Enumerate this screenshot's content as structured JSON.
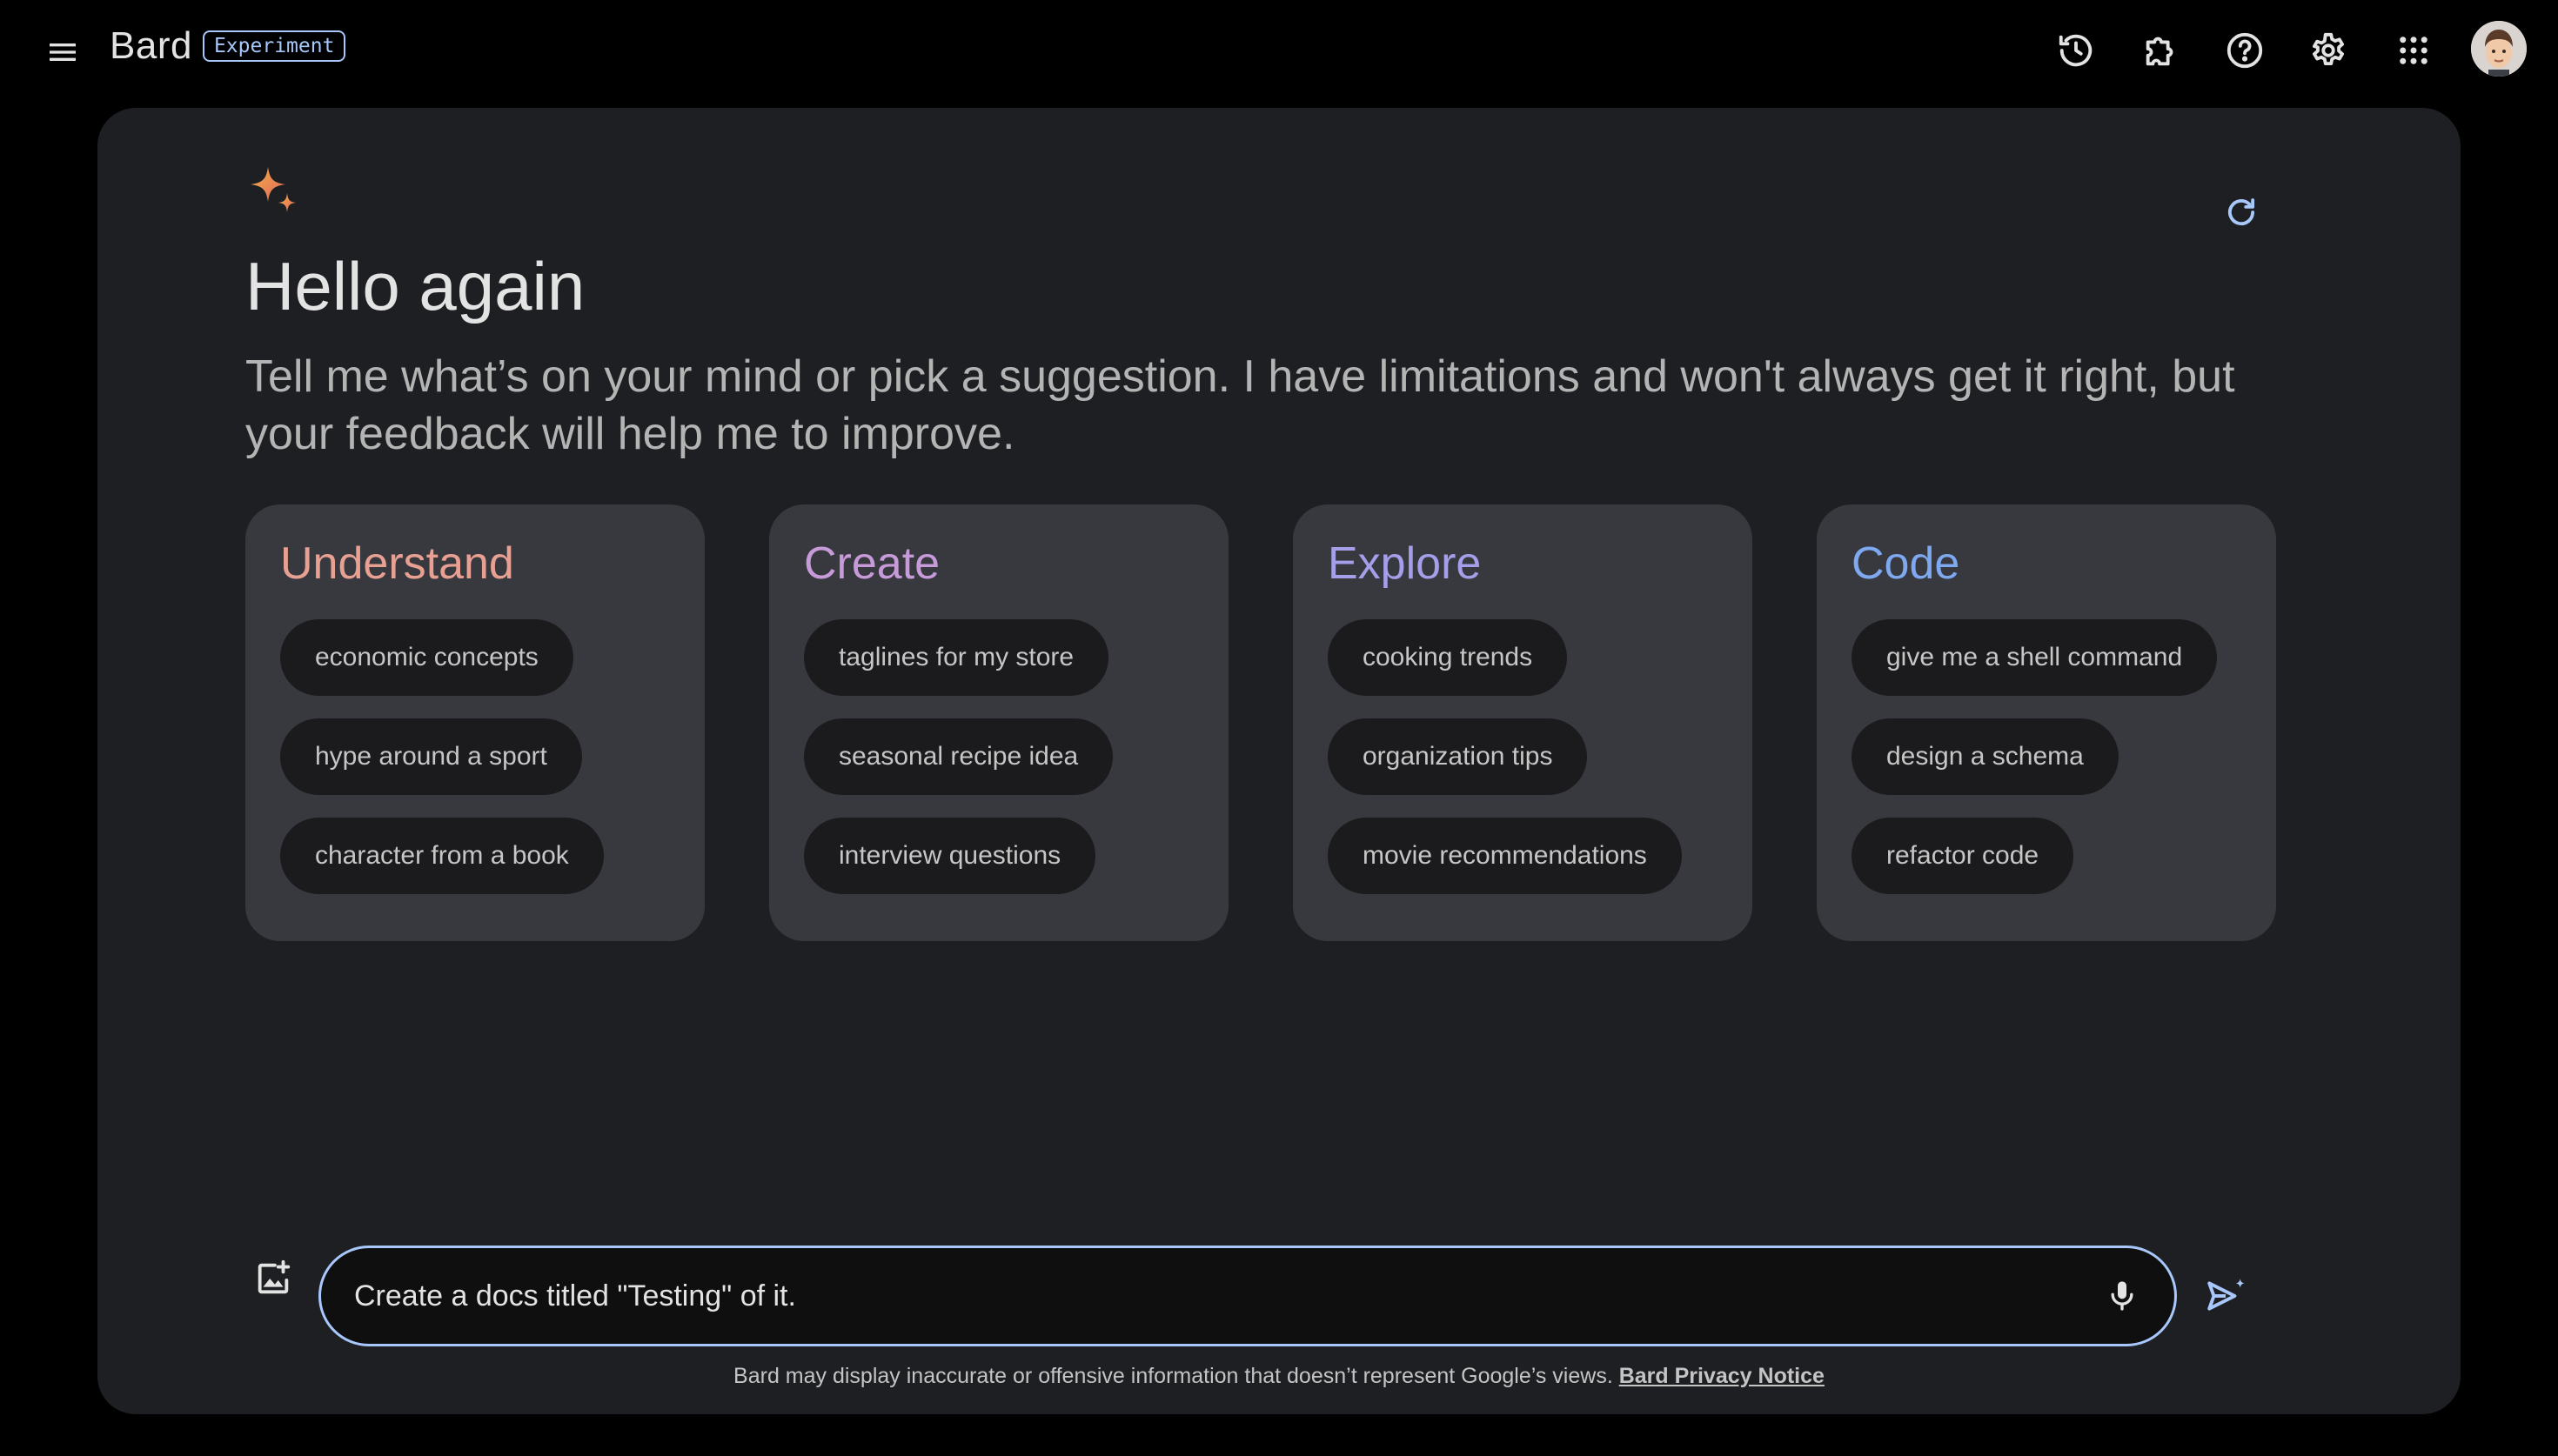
{
  "header": {
    "brand_name": "Bard",
    "badge": "Experiment",
    "icons": [
      "menu-icon",
      "history-icon",
      "extensions-icon",
      "help-icon",
      "settings-icon",
      "apps-icon",
      "avatar"
    ]
  },
  "welcome": {
    "title": "Hello again",
    "intro": "Tell me what’s on your mind or pick a suggestion. I have limitations and won't always get it right, but your feedback will help me to improve."
  },
  "cards": [
    {
      "title": "Understand",
      "color": "#e8a093",
      "chips": [
        "economic concepts",
        "hype around a sport",
        "character from a book"
      ]
    },
    {
      "title": "Create",
      "color": "#c79ad9",
      "chips": [
        "taglines for my store",
        "seasonal recipe idea",
        "interview questions"
      ]
    },
    {
      "title": "Explore",
      "color": "#a59ee8",
      "chips": [
        "cooking trends",
        "organization tips",
        "movie recommendations"
      ]
    },
    {
      "title": "Code",
      "color": "#7ea8f0",
      "chips": [
        "give me a shell command",
        "design a schema",
        "refactor code"
      ]
    }
  ],
  "input": {
    "value": "Create a docs titled \"Testing\" of it. "
  },
  "footer": {
    "disclaimer": "Bard may display inaccurate or offensive information that doesn’t represent Google’s views.",
    "privacy_link": "Bard Privacy Notice"
  },
  "colors": {
    "background": "#000000",
    "panel": "#1e1f22",
    "card": "#37393f",
    "chip": "#1b1b1d",
    "accent": "#a8c7fa"
  }
}
